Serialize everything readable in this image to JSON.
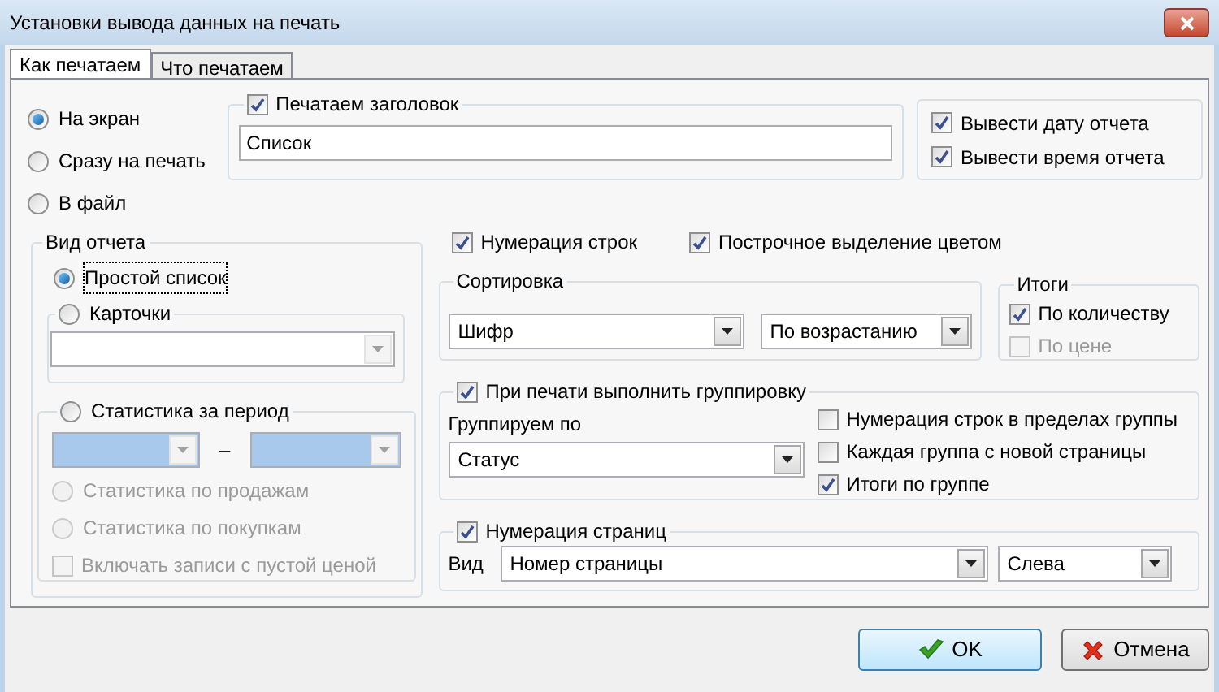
{
  "window": {
    "title": "Установки вывода данных на печать"
  },
  "tabs": [
    {
      "label": "Как печатаем",
      "selected": true
    },
    {
      "label": "Что печатаем",
      "selected": false
    }
  ],
  "output_modes": [
    {
      "label": "На экран",
      "selected": true
    },
    {
      "label": "Сразу на печать",
      "selected": false
    },
    {
      "label": "В файл",
      "selected": false
    }
  ],
  "print_header": {
    "label": "Печатаем заголовок",
    "checked": true,
    "value": "Список"
  },
  "report_stamp": [
    {
      "label": "Вывести дату отчета",
      "checked": true
    },
    {
      "label": "Вывести время отчета",
      "checked": true
    }
  ],
  "report_type": {
    "title": "Вид отчета",
    "simple_list": {
      "label": "Простой список",
      "selected": true
    },
    "cards": {
      "label": "Карточки",
      "selected": false
    },
    "period_stats": {
      "label": "Статистика за период",
      "selected": false,
      "separator": "–",
      "stats": [
        {
          "label": "Статистика по продажам",
          "selected": false,
          "disabled": true
        },
        {
          "label": "Статистика по покупкам",
          "selected": false,
          "disabled": true
        }
      ],
      "empty_price": {
        "label": "Включать записи с пустой ценой",
        "checked": false,
        "disabled": true
      }
    }
  },
  "row_options": [
    {
      "label": "Нумерация строк",
      "checked": true
    },
    {
      "label": "Построчное выделение цветом",
      "checked": true
    }
  ],
  "sorting": {
    "title": "Сортировка",
    "field": "Шифр",
    "order": "По возрастанию"
  },
  "totals": {
    "title": "Итоги",
    "items": [
      {
        "label": "По количеству",
        "checked": true,
        "disabled": false
      },
      {
        "label": "По цене",
        "checked": false,
        "disabled": true
      }
    ]
  },
  "grouping": {
    "label": "При печати выполнить группировку",
    "checked": true,
    "group_by_label": "Группируем по",
    "group_by": "Статус",
    "options": [
      {
        "label": "Нумерация строк в пределах группы",
        "checked": false
      },
      {
        "label": "Каждая группа с новой страницы",
        "checked": false
      },
      {
        "label": "Итоги по группе",
        "checked": true
      }
    ]
  },
  "page_numbering": {
    "label": "Нумерация страниц",
    "checked": true,
    "view_label": "Вид",
    "view": "Номер страницы",
    "position": "Слева"
  },
  "buttons": [
    {
      "kind": "ok",
      "label": "OK"
    },
    {
      "kind": "cancel",
      "label": "Отмена"
    }
  ]
}
